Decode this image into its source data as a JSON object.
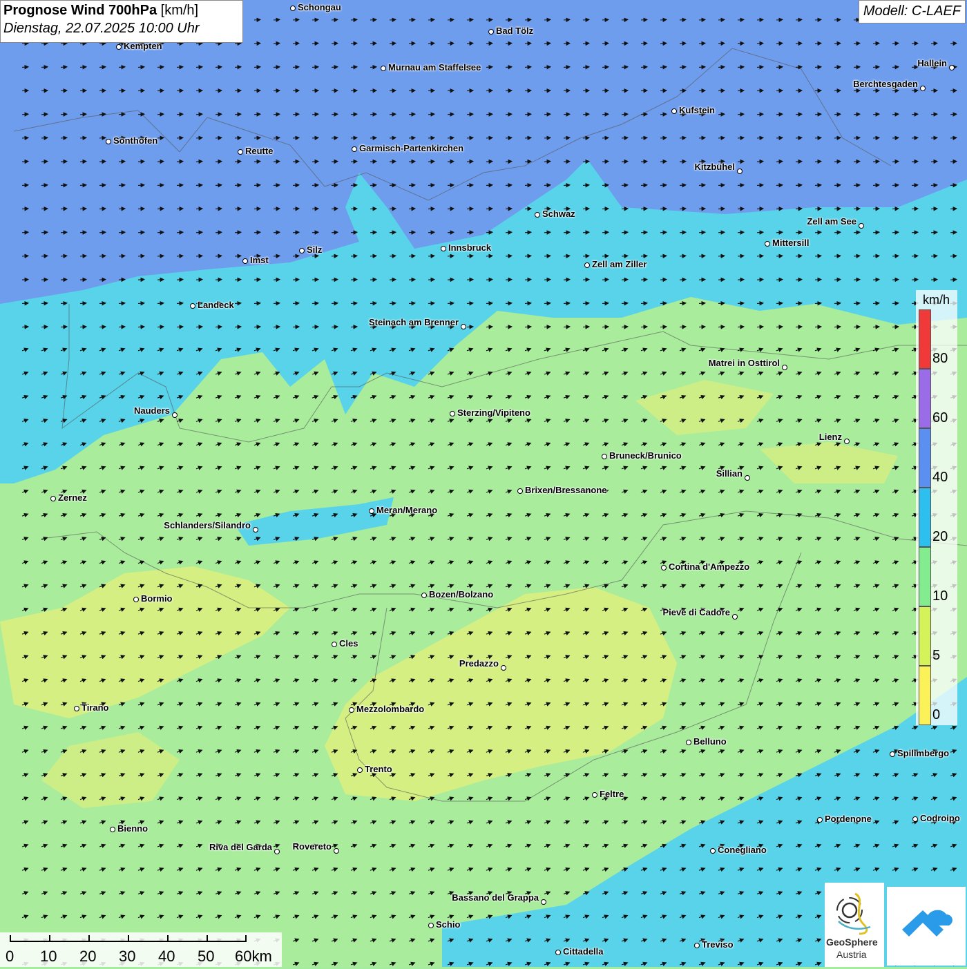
{
  "title": {
    "main_bold": "Prognose Wind 700hPa",
    "unit": "[km/h]",
    "datetime": "Dienstag, 22.07.2025 10:00 Uhr"
  },
  "model_label": "Modell: C-LAEF",
  "legend": {
    "unit": "km/h",
    "ticks": [
      "80",
      "60",
      "40",
      "20",
      "10",
      "5",
      "0"
    ],
    "colors": [
      "#f03a3a",
      "#9a6ce8",
      "#5b8ff0",
      "#2dc0ee",
      "#82ec8e",
      "#d4f25a",
      "#fbf25a"
    ]
  },
  "colors": {
    "band_0_5": "#e6f07a",
    "band_5_10": "#a8ec9c",
    "band_10_20": "#58d3ea",
    "band_20_40": "#6f9ded",
    "band_40_60": "#7f8ee8"
  },
  "cities": [
    {
      "name": "Schongau"
    },
    {
      "name": "Bad Tölz"
    },
    {
      "name": "Kempten"
    },
    {
      "name": "Murnau am Staffelsee"
    },
    {
      "name": "Hallein"
    },
    {
      "name": "Berchtesgaden"
    },
    {
      "name": "Kufstein"
    },
    {
      "name": "Sonthofen"
    },
    {
      "name": "Reutte"
    },
    {
      "name": "Garmisch-Partenkirchen"
    },
    {
      "name": "Kitzbühel"
    },
    {
      "name": "Schwaz"
    },
    {
      "name": "Zell am See"
    },
    {
      "name": "Mittersill"
    },
    {
      "name": "Innsbruck"
    },
    {
      "name": "Imst"
    },
    {
      "name": "Silz"
    },
    {
      "name": "Zell am Ziller"
    },
    {
      "name": "Landeck"
    },
    {
      "name": "Steinach am Brenner"
    },
    {
      "name": "Matrei in Osttirol"
    },
    {
      "name": "Nauders"
    },
    {
      "name": "Sterzing/Vipiteno"
    },
    {
      "name": "Lienz"
    },
    {
      "name": "Bruneck/Brunico"
    },
    {
      "name": "Sillian"
    },
    {
      "name": "Brixen/Bressanone"
    },
    {
      "name": "Zernez"
    },
    {
      "name": "Meran/Merano"
    },
    {
      "name": "Schlanders/Silandro"
    },
    {
      "name": "Cortina d'Ampezzo"
    },
    {
      "name": "Bozen/Bolzano"
    },
    {
      "name": "Bormio"
    },
    {
      "name": "Pieve di Cadore"
    },
    {
      "name": "Cles"
    },
    {
      "name": "Predazzo"
    },
    {
      "name": "Tirano"
    },
    {
      "name": "Mezzolombardo"
    },
    {
      "name": "Belluno"
    },
    {
      "name": "Spilimbergo"
    },
    {
      "name": "Trento"
    },
    {
      "name": "Feltre"
    },
    {
      "name": "Pordenone"
    },
    {
      "name": "Codroipo"
    },
    {
      "name": "Bienno"
    },
    {
      "name": "Riva del Garda"
    },
    {
      "name": "Rovereto"
    },
    {
      "name": "Conegliano"
    },
    {
      "name": "Bassano del Grappa"
    },
    {
      "name": "Schio"
    },
    {
      "name": "Treviso"
    },
    {
      "name": "Cittadella"
    }
  ],
  "scale_bar": {
    "labels": [
      "0",
      "10",
      "20",
      "30",
      "40",
      "50",
      "60km"
    ]
  },
  "logos": {
    "primary_line1": "GeoSphere",
    "primary_line2": "Austria"
  }
}
